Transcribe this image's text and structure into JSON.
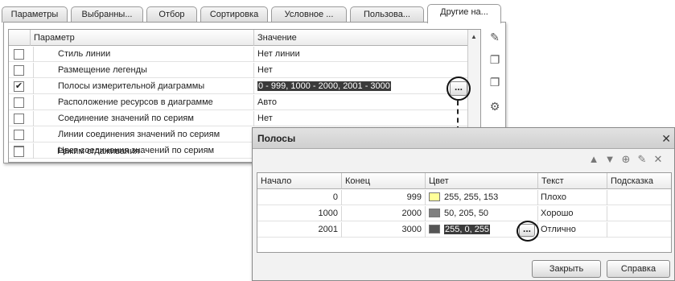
{
  "tabs": [
    {
      "label": "Параметры",
      "active": false
    },
    {
      "label": "Выбранны...",
      "active": false
    },
    {
      "label": "Отбор",
      "active": false
    },
    {
      "label": "Сортировка",
      "active": false
    },
    {
      "label": "Условное ...",
      "active": false
    },
    {
      "label": "Пользова...",
      "active": false
    },
    {
      "label": "Другие на...",
      "active": true
    }
  ],
  "grid": {
    "col_param": "Параметр",
    "col_value": "Значение",
    "rows": [
      {
        "name": "Стиль линии",
        "value": "Нет линии",
        "checked": false
      },
      {
        "name": "Размещение легенды",
        "value": "Нет",
        "checked": false
      },
      {
        "name": "Полосы измерительной диаграммы",
        "value": "0 - 999, 1000 - 2000, 2001 - 3000",
        "checked": true
      },
      {
        "name": "Расположение ресурсов в диаграмме",
        "value": "Авто",
        "checked": false
      },
      {
        "name": "Соединение значений по сериям",
        "value": "Нет",
        "checked": false
      },
      {
        "name": "Линии соединения значений по сериям",
        "value": "",
        "checked": false
      },
      {
        "name": "Цвет соединения значений по сериям",
        "value": "",
        "checked": false
      },
      {
        "name": "Режим сглаживания",
        "value": "",
        "checked": false
      }
    ],
    "check_mark": "✔",
    "dots_label": "..."
  },
  "icons": {
    "edit": "pencil-icon",
    "copy": "copy-icon",
    "paste": "paste-icon",
    "settings": "settings-icon"
  },
  "dialog": {
    "title": "Полосы",
    "close_glyph": "✕",
    "columns": [
      "Начало",
      "Конец",
      "Цвет",
      "Текст",
      "Подсказка"
    ],
    "rows": [
      {
        "start": "0",
        "end": "999",
        "color": "255, 255, 153",
        "swatch": "#ffff99",
        "text": "Плохо",
        "hint": ""
      },
      {
        "start": "1000",
        "end": "2000",
        "color": "50, 205, 50",
        "swatch": "#32cd32",
        "text": "Хорошо",
        "hint": ""
      },
      {
        "start": "2001",
        "end": "3000",
        "color": "255, 0, 255",
        "swatch": "#ff00ff",
        "text": "Отлично",
        "hint": ""
      }
    ],
    "dots_label": "...",
    "close_button": "Закрыть",
    "help_button": "Справка"
  }
}
